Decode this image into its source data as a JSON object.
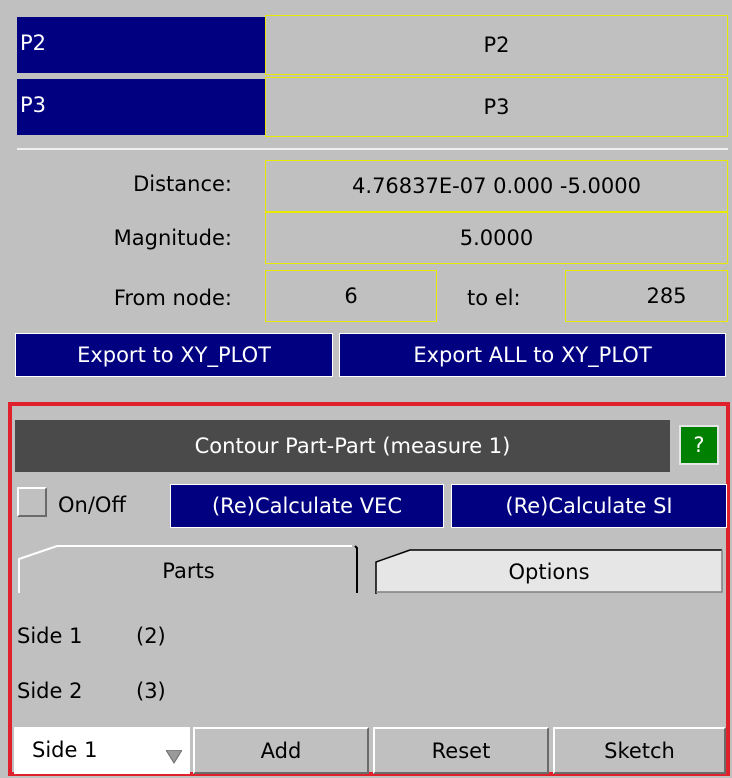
{
  "points": [
    {
      "label": "P2",
      "value": "P2"
    },
    {
      "label": "P3",
      "value": "P3"
    }
  ],
  "measure": {
    "distance_label": "Distance:",
    "distance_value": "4.76837E-07 0.000 -5.0000",
    "magnitude_label": "Magnitude:",
    "magnitude_value": "5.0000",
    "from_node_label": "From node:",
    "from_node_value": "6",
    "to_el_label": "to el:",
    "to_el_value": "285"
  },
  "export": {
    "export_label": "Export to XY_PLOT",
    "export_all_label": "Export ALL to XY_PLOT"
  },
  "contour": {
    "title": "Contour Part-Part (measure 1)",
    "help": "?",
    "onoff_label": "On/Off",
    "recalc_vec": "(Re)Calculate VEC",
    "recalc_si": "(Re)Calculate SI",
    "tabs": [
      {
        "label": "Parts"
      },
      {
        "label": "Options"
      }
    ],
    "sides": [
      {
        "label": "Side 1",
        "value": "(2)"
      },
      {
        "label": "Side 2",
        "value": "(3)"
      }
    ],
    "bottom": {
      "side_select": "Side 1",
      "add": "Add",
      "reset": "Reset",
      "sketch": "Sketch"
    }
  },
  "colors": {
    "panel": "#c0c0c0",
    "navy": "#000080",
    "highlight_border": "#e8e800",
    "frame_red": "#e0202a",
    "title_bar": "#4a4a4a",
    "help_green": "#008000"
  }
}
